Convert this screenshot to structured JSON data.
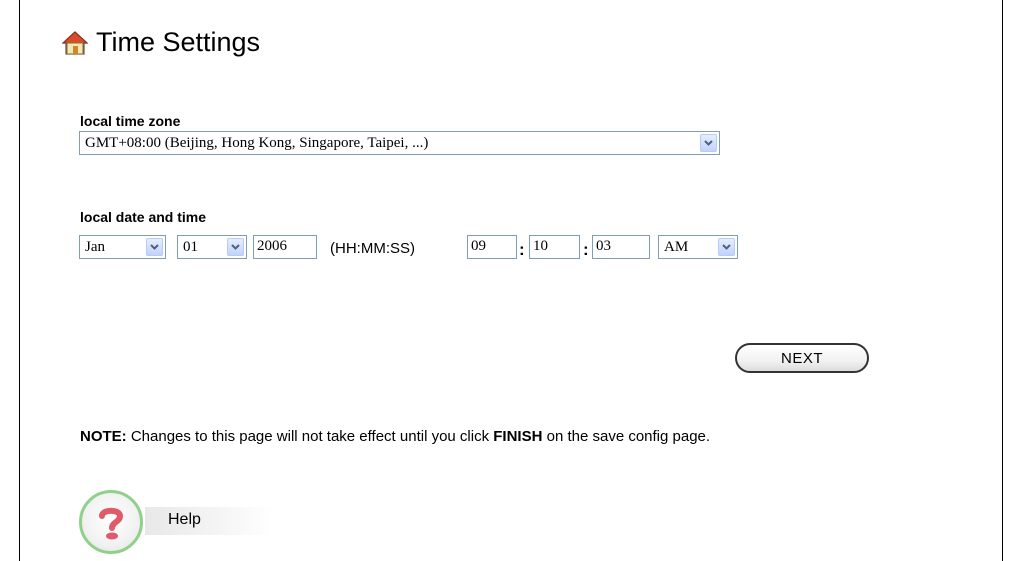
{
  "page": {
    "title": "Time Settings"
  },
  "timezone": {
    "label": "local time zone",
    "selected": "GMT+08:00 (Beijing, Hong Kong, Singapore, Taipei, ...)"
  },
  "datetime": {
    "label": "local date and time",
    "month": "Jan",
    "day": "01",
    "year": "2006",
    "format_hint": "(HH:MM:SS)",
    "hour": "09",
    "minute": "10",
    "second": "03",
    "ampm": "AM",
    "separator": ":"
  },
  "buttons": {
    "next": "NEXT"
  },
  "note": {
    "prefix": "NOTE:",
    "text1": " Changes to this page will not take effect until you click ",
    "finish": "FINISH",
    "text2": " on the save config page."
  },
  "help": {
    "label": "Help"
  },
  "colors": {
    "select_border": "#7f9db9",
    "help_ring": "#8fd18a",
    "help_icon": "#e05a6a"
  },
  "icons": {
    "title": "home-icon",
    "dropdown": "chevron-down-icon",
    "help": "question-icon"
  }
}
